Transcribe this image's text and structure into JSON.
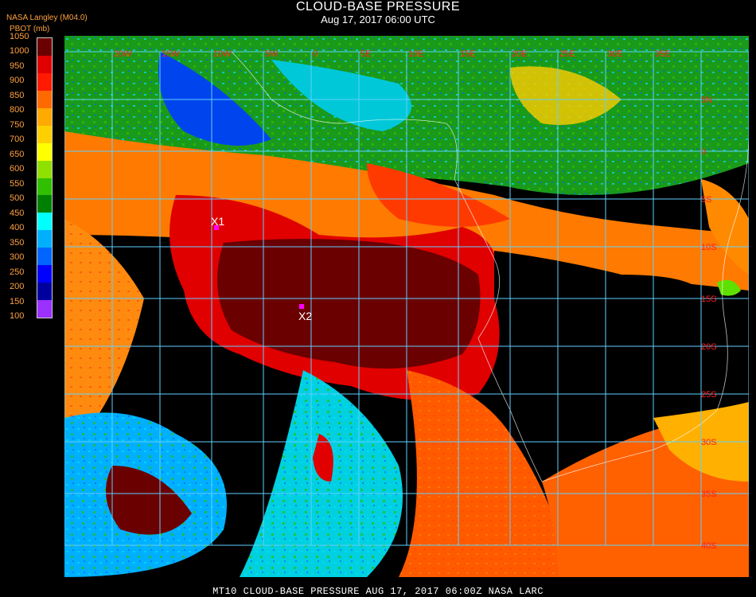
{
  "header": {
    "title": "CLOUD-BASE PRESSURE",
    "subtitle": "Aug 17, 2017 06:00 UTC",
    "agency": "NASA Langley (M04.0)",
    "units": "PBOT (mb)"
  },
  "legend": {
    "ticks": [
      "1050",
      "1000",
      "950",
      "900",
      "850",
      "800",
      "750",
      "700",
      "650",
      "600",
      "550",
      "500",
      "450",
      "400",
      "350",
      "300",
      "250",
      "200",
      "150",
      "100"
    ],
    "colors": [
      "#6b0000",
      "#e00000",
      "#ff1a00",
      "#ff6a00",
      "#ffaa00",
      "#ffd000",
      "#ffff00",
      "#90e000",
      "#30c000",
      "#008000",
      "#00ffff",
      "#00b0ff",
      "#0066ff",
      "#0000ff",
      "#0000a0",
      "#9b30ff"
    ]
  },
  "map": {
    "lat_labels": [
      "5N",
      "0",
      "5S",
      "10S",
      "15S",
      "20S",
      "25S",
      "30S",
      "35S",
      "40S"
    ],
    "lon_labels": [
      "20W",
      "15W",
      "10W",
      "5W",
      "0",
      "5E",
      "10E",
      "15E",
      "20E",
      "25E",
      "30E",
      "35E"
    ],
    "markers": [
      {
        "label": "X1"
      },
      {
        "label": "X2"
      }
    ]
  },
  "footer": {
    "text": "MT10   CLOUD-BASE PRESSURE   AUG 17, 2017 06:00Z   NASA LARC"
  }
}
